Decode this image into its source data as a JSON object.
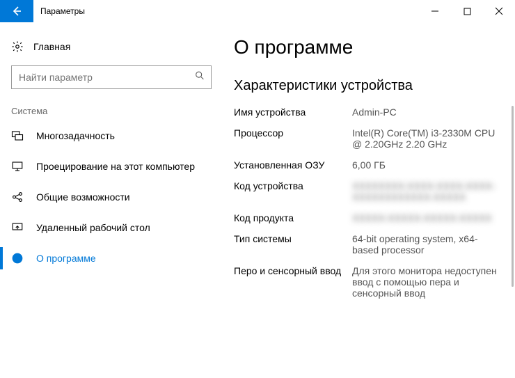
{
  "titlebar": {
    "title": "Параметры"
  },
  "sidebar": {
    "home_label": "Главная",
    "search_placeholder": "Найти параметр",
    "section_label": "Система",
    "items": [
      {
        "label": "Многозадачность"
      },
      {
        "label": "Проецирование на этот компьютер"
      },
      {
        "label": "Общие возможности"
      },
      {
        "label": "Удаленный рабочий стол"
      },
      {
        "label": "О программе"
      }
    ]
  },
  "content": {
    "page_title": "О программе",
    "section_title": "Характеристики устройства",
    "specs": {
      "device_name_label": "Имя устройства",
      "device_name_value": "Admin-PC",
      "processor_label": "Процессор",
      "processor_value": "Intel(R) Core(TM) i3-2330M CPU @ 2.20GHz 2.20 GHz",
      "ram_label": "Установленная ОЗУ",
      "ram_value": "6,00 ГБ",
      "device_id_label": "Код устройства",
      "device_id_value": "XXXXXXXX-XXXX-XXXX-XXXX-XXXXXXXXXXXX-XXXXX",
      "product_id_label": "Код продукта",
      "product_id_value": "XXXXX-XXXXX-XXXXX-XXXXX",
      "system_type_label": "Тип системы",
      "system_type_value": "64-bit operating system, x64-based processor",
      "pen_touch_label": "Перо и сенсорный ввод",
      "pen_touch_value": "Для этого монитора недоступен ввод с помощью пера и сенсорный ввод"
    }
  }
}
